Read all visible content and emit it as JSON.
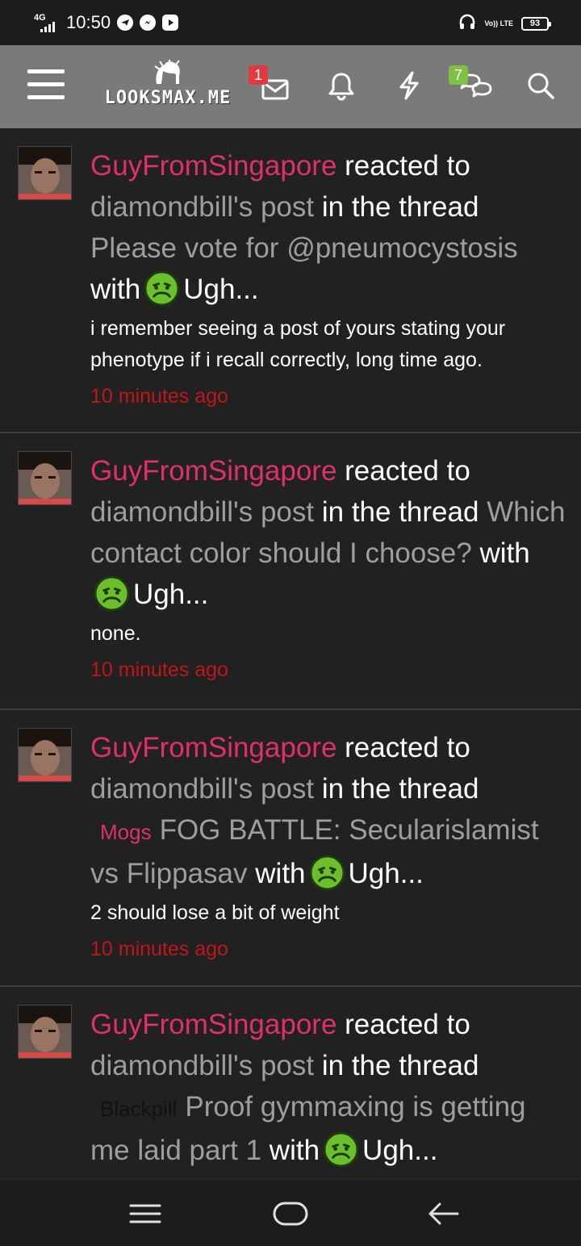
{
  "status_bar": {
    "network": "4G",
    "time": "10:50",
    "volte": "Vo)) LTE",
    "battery": "93",
    "notification_icons": [
      "telegram-icon",
      "messenger-icon",
      "youtube-icon"
    ],
    "right_icons": [
      "headphones-icon",
      "volte-icon",
      "battery-icon"
    ]
  },
  "header": {
    "logo_text": "LOOKSMAX.ME",
    "menu_icon": "hamburger-icon",
    "inbox_badge": "1",
    "alerts_icon": "bell-icon",
    "whats_new_icon": "bolt-icon",
    "conversations_badge": "7",
    "search_icon": "search-icon",
    "colors": {
      "background": "#7a7a7a",
      "badge_red": "#e2393f",
      "badge_green": "#7fc241"
    }
  },
  "feed": {
    "colors": {
      "username": "#e0306b",
      "link": "#9e9e9e",
      "time": "#c0161b"
    },
    "items": [
      {
        "user": "GuyFromSingapore",
        "action": "reacted to",
        "post_link": "diamondbill's post",
        "in_thread": "in the thread",
        "prefix": "",
        "thread_title": "Please vote for @pneumocystosis",
        "with": "with",
        "reaction": "Ugh...",
        "snippet": "i remember seeing a post of yours stating your phenotype if i recall correctly, long time ago.",
        "time": "10 minutes ago"
      },
      {
        "user": "GuyFromSingapore",
        "action": "reacted to",
        "post_link": "diamondbill's post",
        "in_thread": "in the thread",
        "prefix": "",
        "thread_title": "Which contact color should I choose?",
        "with": "with",
        "reaction": "Ugh...",
        "snippet": "none.",
        "time": "10 minutes ago"
      },
      {
        "user": "GuyFromSingapore",
        "action": "reacted to",
        "post_link": "diamondbill's post",
        "in_thread": "in the thread",
        "prefix": "Mogs",
        "thread_title": "FOG BATTLE: Secularislamist vs Flippasav",
        "with": "with",
        "reaction": "Ugh...",
        "snippet": "2 should lose a bit of weight",
        "time": "10 minutes ago"
      },
      {
        "user": "GuyFromSingapore",
        "action": "reacted to",
        "post_link": "diamondbill's post",
        "in_thread": "in the thread",
        "prefix": "Blackpill",
        "thread_title": "Proof gymmaxing is getting me laid part 1",
        "with": "with",
        "reaction": "Ugh...",
        "snippet": "",
        "time": ""
      }
    ]
  },
  "nav_bar": {
    "icons": [
      "recent-apps-icon",
      "home-icon",
      "back-icon"
    ]
  }
}
